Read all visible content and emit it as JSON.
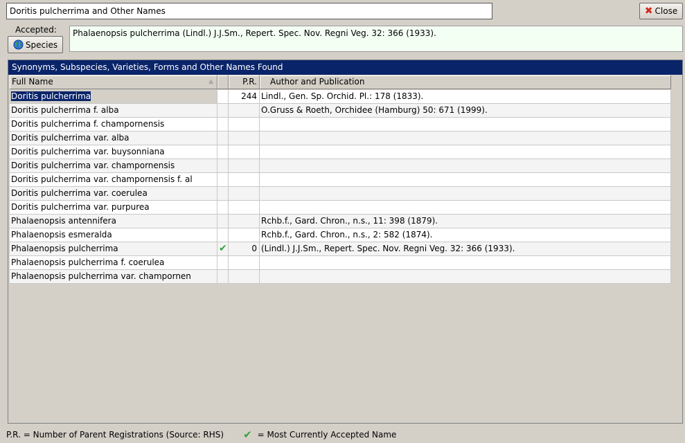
{
  "header": {
    "title": "Doritis pulcherrima and Other Names",
    "close_label": "Close",
    "accepted_label": "Accepted:",
    "species_label": "Species",
    "accepted_value": "Phalaenopsis pulcherrima (Lindl.) J.J.Sm., Repert. Spec. Nov. Regni Veg. 32: 366 (1933)."
  },
  "grid": {
    "caption": "Synonyms, Subspecies, Varieties, Forms and Other Names Found",
    "columns": {
      "name": "Full Name",
      "check": "",
      "pr": "P.R.",
      "author": "Author and Publication"
    },
    "rows": [
      {
        "name": "Doritis pulcherrima",
        "accepted": false,
        "pr": "244",
        "author": "Lindl., Gen. Sp. Orchid. Pl.: 178 (1833).",
        "selected": true
      },
      {
        "name": "Doritis pulcherrima f. alba",
        "accepted": false,
        "pr": "",
        "author": "O.Gruss & Roeth, Orchidee (Hamburg) 50: 671 (1999)."
      },
      {
        "name": "Doritis pulcherrima f. champornensis",
        "accepted": false,
        "pr": "",
        "author": ""
      },
      {
        "name": "Doritis pulcherrima var. alba",
        "accepted": false,
        "pr": "",
        "author": ""
      },
      {
        "name": "Doritis pulcherrima var. buysonniana",
        "accepted": false,
        "pr": "",
        "author": ""
      },
      {
        "name": "Doritis pulcherrima var. champornensis",
        "accepted": false,
        "pr": "",
        "author": ""
      },
      {
        "name": "Doritis pulcherrima var. champornensis f. al",
        "accepted": false,
        "pr": "",
        "author": ""
      },
      {
        "name": "Doritis pulcherrima var. coerulea",
        "accepted": false,
        "pr": "",
        "author": ""
      },
      {
        "name": "Doritis pulcherrima var. purpurea",
        "accepted": false,
        "pr": "",
        "author": ""
      },
      {
        "name": "Phalaenopsis antennifera",
        "accepted": false,
        "pr": "",
        "author": "Rchb.f., Gard. Chron., n.s., 11: 398 (1879)."
      },
      {
        "name": "Phalaenopsis esmeralda",
        "accepted": false,
        "pr": "",
        "author": "Rchb.f., Gard. Chron., n.s., 2: 582 (1874)."
      },
      {
        "name": "Phalaenopsis pulcherrima",
        "accepted": true,
        "pr": "0",
        "author": "(Lindl.) J.J.Sm., Repert. Spec. Nov. Regni Veg. 32: 366 (1933)."
      },
      {
        "name": "Phalaenopsis pulcherrima f. coerulea",
        "accepted": false,
        "pr": "",
        "author": ""
      },
      {
        "name": "Phalaenopsis pulcherrima var. champornen",
        "accepted": false,
        "pr": "",
        "author": ""
      }
    ]
  },
  "footer": {
    "pr_legend": "P.R. = Number of Parent Registrations (Source: RHS)",
    "check_legend": "= Most Currently Accepted Name"
  },
  "icons": {
    "close": "close-x-icon",
    "species": "globe-icon",
    "accepted": "check-icon",
    "sort": "sort-ascending-icon"
  },
  "colors": {
    "caption_bg": "#0a246a",
    "check_green": "#2ea43a",
    "close_red": "#d42a1e",
    "accepted_bg": "#f4fff4"
  }
}
